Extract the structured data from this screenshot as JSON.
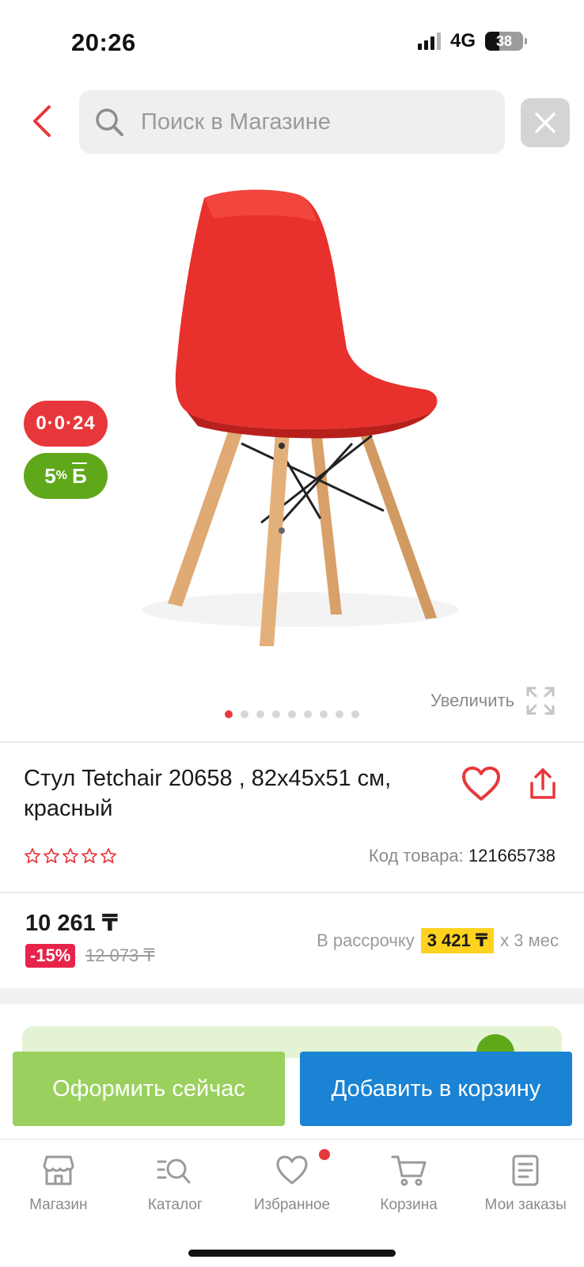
{
  "status_bar": {
    "time": "20:26",
    "network": "4G",
    "battery": "38",
    "battery_level": 0.38
  },
  "header": {
    "search_placeholder": "Поиск в Магазине",
    "icons": [
      "chevron-left-icon",
      "search-icon",
      "close-icon"
    ]
  },
  "gallery": {
    "badge_installment": "0·0·24",
    "badge_bonus_percent": "5",
    "badge_bonus_symbol": "%",
    "badge_bonus_currency": "Б",
    "zoom_label": "Увеличить",
    "dots_total": 9,
    "active_dot": 1
  },
  "product": {
    "title": "Стул Tetchair 20658 , 82x45x51 см, красный",
    "rating_stars": 5,
    "rating_value": 0,
    "sku_label": "Код товара:",
    "sku_value": "121665738"
  },
  "pricing": {
    "price": "10 261 ₸",
    "discount": "-15%",
    "old_price": "12 073 ₸",
    "installment_prefix": "В рассрочку",
    "installment_amount": "3 421 ₸",
    "installment_suffix": "x 3 мес"
  },
  "actions": {
    "buy_now": "Оформить сейчас",
    "add_to_cart": "Добавить в корзину"
  },
  "bottom_nav": {
    "items": [
      {
        "label": "Магазин",
        "icon": "store-icon"
      },
      {
        "label": "Каталог",
        "icon": "catalog-search-icon"
      },
      {
        "label": "Избранное",
        "icon": "heart-icon",
        "has_dot": true
      },
      {
        "label": "Корзина",
        "icon": "cart-icon"
      },
      {
        "label": "Мои заказы",
        "icon": "orders-icon"
      }
    ]
  },
  "colors": {
    "accent_red": "#e8373b",
    "green": "#5ea81a",
    "buy_button": "#9ad15e",
    "cart_button": "#1a83d4",
    "installment_highlight": "#ffd21f"
  }
}
